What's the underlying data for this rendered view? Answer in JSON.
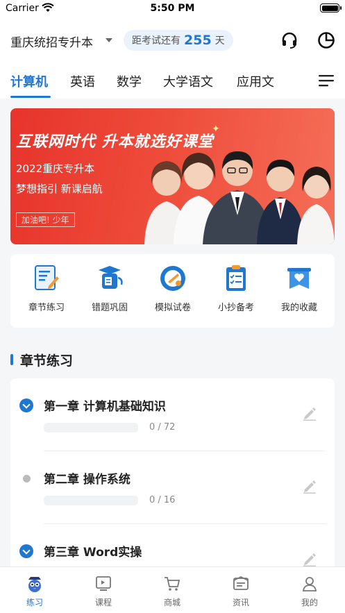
{
  "status_bar": {
    "carrier": "Carrier",
    "time": "5:50 PM"
  },
  "header": {
    "exam_name": "重庆统招专升本",
    "countdown_prefix": "距考试还有",
    "countdown_days": "255",
    "countdown_suffix": "天"
  },
  "subject_tabs": [
    {
      "label": "计算机",
      "active": true
    },
    {
      "label": "英语",
      "active": false
    },
    {
      "label": "数学",
      "active": false
    },
    {
      "label": "大学语文",
      "active": false
    },
    {
      "label": "应用文",
      "active": false
    }
  ],
  "banner": {
    "headline": "互联网时代  升本就选好课堂",
    "line1": "2022重庆专升本",
    "line2": "梦想指引 新课启航",
    "tag": "加油吧! 少年"
  },
  "quick_actions": [
    {
      "label": "章节练习",
      "icon": "chapter-practice-icon"
    },
    {
      "label": "错题巩固",
      "icon": "wrong-questions-icon"
    },
    {
      "label": "模拟试卷",
      "icon": "mock-exam-icon"
    },
    {
      "label": "小抄备考",
      "icon": "notes-icon"
    },
    {
      "label": "我的收藏",
      "icon": "favorites-icon"
    }
  ],
  "section": {
    "title": "章节练习"
  },
  "chapters": [
    {
      "title": "第一章 计算机基础知识",
      "count": "0 / 72",
      "done": 0,
      "total": 72,
      "expanded": true
    },
    {
      "title": "第二章 操作系统",
      "count": "0 / 16",
      "done": 0,
      "total": 16,
      "expanded": false
    },
    {
      "title": "第三章 Word实操",
      "count": "",
      "done": 0,
      "total": 0,
      "expanded": true
    }
  ],
  "tabbar": [
    {
      "label": "练习",
      "active": true,
      "icon": "practice-mascot-icon"
    },
    {
      "label": "课程",
      "active": false,
      "icon": "course-icon"
    },
    {
      "label": "商城",
      "active": false,
      "icon": "cart-icon"
    },
    {
      "label": "资讯",
      "active": false,
      "icon": "news-icon"
    },
    {
      "label": "我的",
      "active": false,
      "icon": "profile-icon"
    }
  ],
  "colors": {
    "accent": "#1f77d0",
    "banner": "#e7342c"
  }
}
